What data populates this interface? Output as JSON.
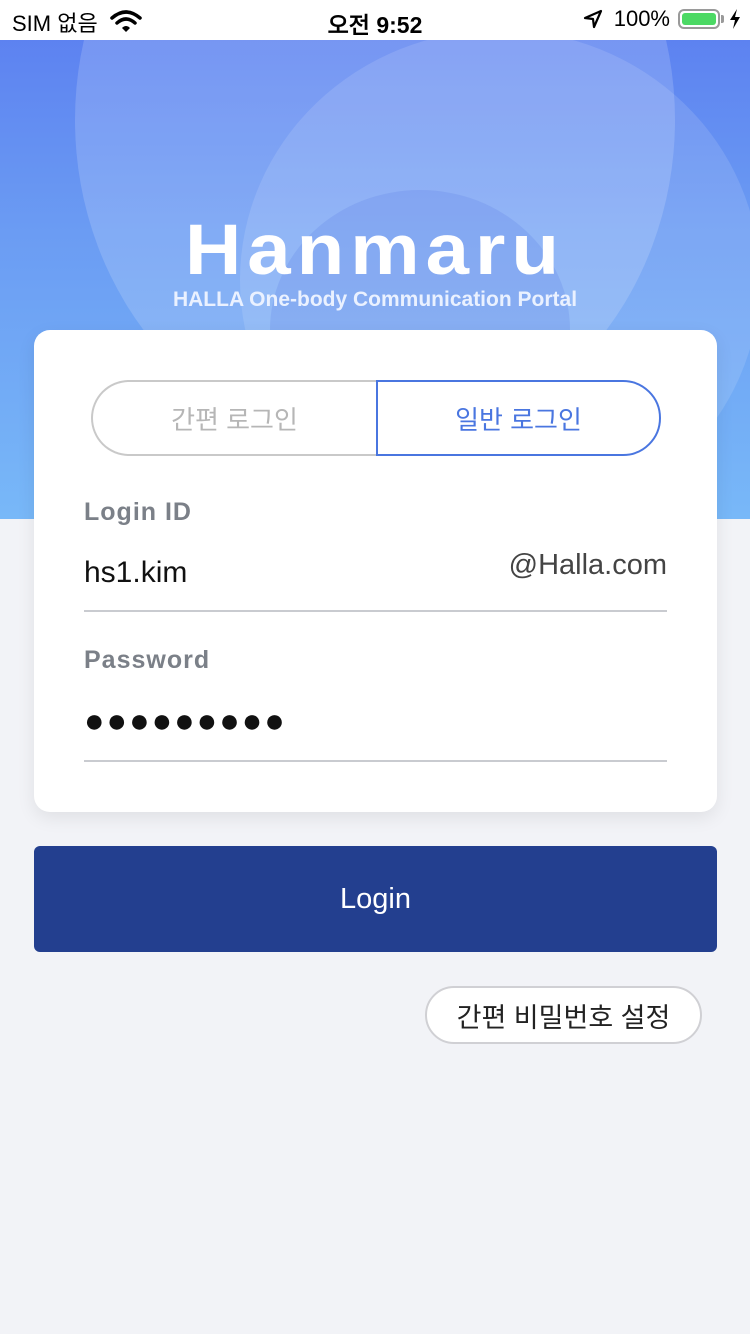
{
  "status_bar": {
    "carrier": "SIM 없음",
    "time": "오전 9:52",
    "battery": "100%",
    "icons": [
      "wifi-icon",
      "location-arrow-icon",
      "battery-icon",
      "charging-bolt-icon"
    ]
  },
  "brand": {
    "logo": "Hanmaru",
    "subtitle": "HALLA One-body Communication Portal"
  },
  "login_mode": {
    "options": [
      "간편 로그인",
      "일반 로그인"
    ],
    "selected": "일반 로그인"
  },
  "form": {
    "login_id": {
      "label": "Login ID",
      "value": "hs1.kim",
      "domain": "@Halla.com"
    },
    "password": {
      "label": "Password",
      "masked_value": "●●●●●●●●●"
    }
  },
  "buttons": {
    "login": "Login",
    "simple_password_setup": "간편 비밀번호 설정"
  },
  "colors": {
    "primary": "#233f8f",
    "accent": "#4a76e0",
    "hero_top": "#5a7df0",
    "hero_bottom": "#78b8f8",
    "background": "#f2f3f7"
  }
}
